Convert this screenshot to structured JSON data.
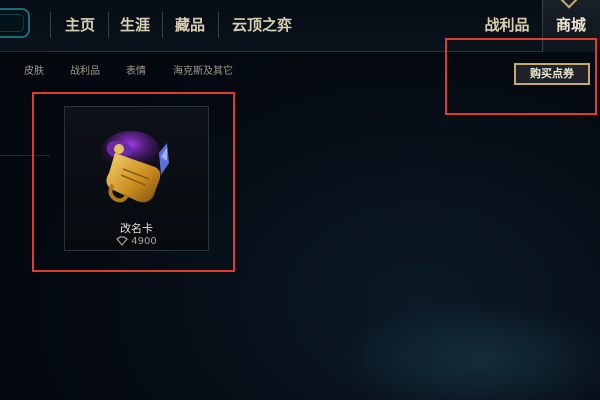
{
  "nav": {
    "items": [
      "主页",
      "生涯",
      "藏品",
      "云顶之弈"
    ],
    "right_items": [
      "战利品",
      "商城"
    ]
  },
  "subnav": {
    "items": [
      "皮肤",
      "战利品",
      "表情",
      "海克斯及其它"
    ],
    "buy_button": "购买点券"
  },
  "store": {
    "items": [
      {
        "name": "改名卡",
        "price": "4900",
        "currency_icon": "rp-icon"
      }
    ]
  },
  "highlight_color": "#e13b2f",
  "accent_color": "#c8aa6e"
}
